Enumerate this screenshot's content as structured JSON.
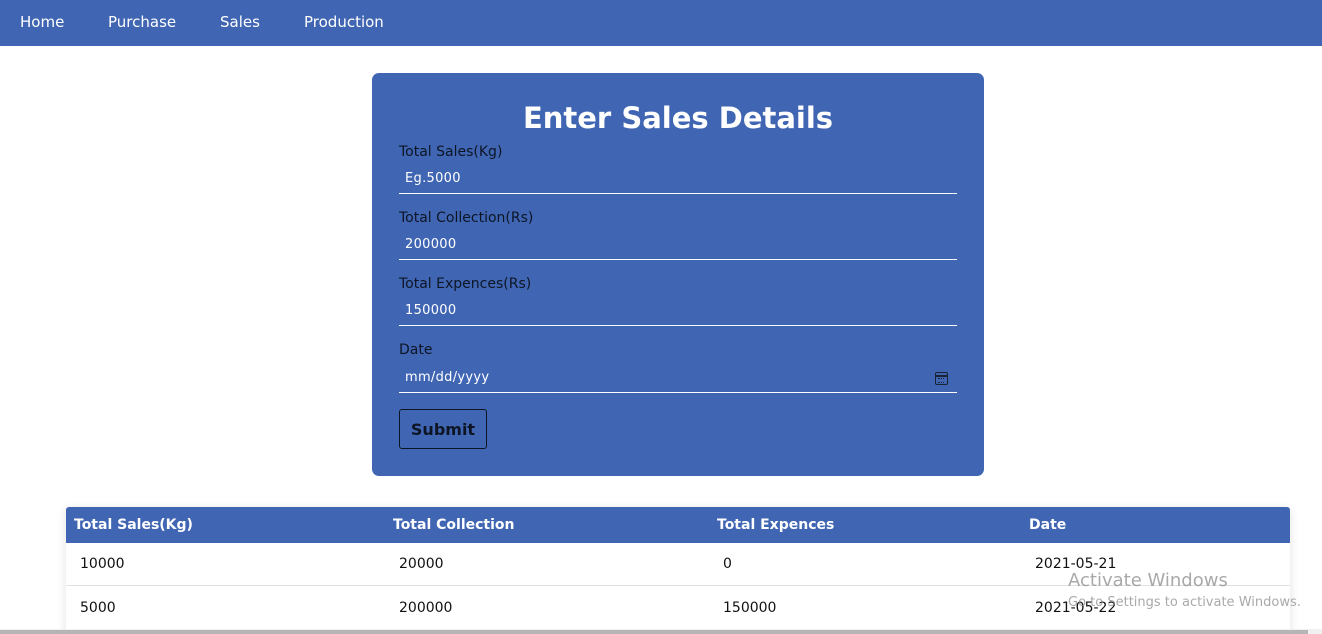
{
  "nav": {
    "items": [
      {
        "label": "Home"
      },
      {
        "label": "Purchase"
      },
      {
        "label": "Sales"
      },
      {
        "label": "Production"
      }
    ]
  },
  "form": {
    "title": "Enter Sales Details",
    "fields": [
      {
        "label": "Total Sales(Kg)",
        "placeholder": "Eg.5000"
      },
      {
        "label": "Total Collection(Rs)",
        "placeholder": "200000"
      },
      {
        "label": "Total Expences(Rs)",
        "placeholder": "150000"
      },
      {
        "label": "Date",
        "placeholder": "mm/dd/yyyy"
      }
    ],
    "submit_label": "Submit"
  },
  "table": {
    "headers": [
      "Total Sales(Kg)",
      "Total Collection",
      "Total Expences",
      "Date"
    ],
    "rows": [
      [
        "10000",
        "20000",
        "0",
        "2021-05-21"
      ],
      [
        "5000",
        "200000",
        "150000",
        "2021-05-22"
      ]
    ]
  },
  "watermark": {
    "title": "Activate Windows",
    "subtitle": "Go to Settings to activate Windows."
  },
  "colors": {
    "primary": "#4066b3",
    "text_dark": "#0d1525"
  }
}
